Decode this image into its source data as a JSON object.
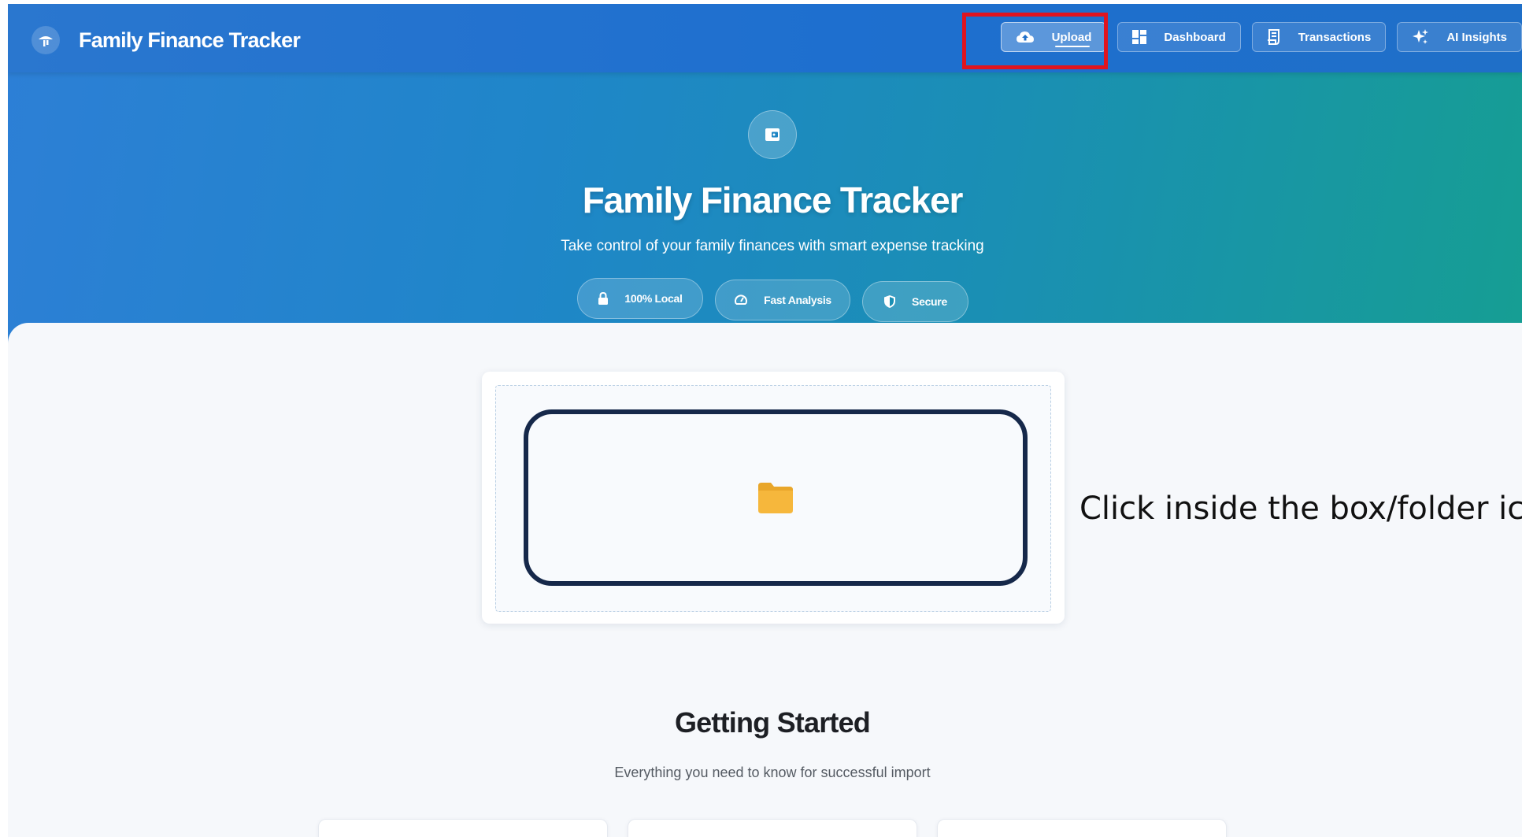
{
  "app": {
    "title": "Family Finance Tracker"
  },
  "nav": {
    "items": [
      {
        "label": "Upload",
        "icon": "cloud-upload-icon",
        "active": true
      },
      {
        "label": "Dashboard",
        "icon": "dashboard-grid-icon",
        "active": false
      },
      {
        "label": "Transactions",
        "icon": "receipt-icon",
        "active": false
      },
      {
        "label": "AI Insights",
        "icon": "sparkle-icon",
        "active": false
      }
    ]
  },
  "hero": {
    "icon": "wallet-icon",
    "title": "Family Finance Tracker",
    "subtitle": "Take control of your family finances with smart expense tracking",
    "features": [
      {
        "label": "100% Local",
        "icon": "lock-icon"
      },
      {
        "label": "Fast Analysis",
        "icon": "speedometer-icon"
      },
      {
        "label": "Secure",
        "icon": "shield-icon"
      }
    ]
  },
  "upload": {
    "icon": "folder-icon"
  },
  "annotation": {
    "instruction": "Click inside the box/folder ico"
  },
  "getting_started": {
    "title": "Getting Started",
    "subtitle": "Everything you need to know for successful import"
  },
  "colors": {
    "highlight": "#e0141e",
    "drop_zone_border": "#16284a",
    "folder": "#f6b73c"
  }
}
